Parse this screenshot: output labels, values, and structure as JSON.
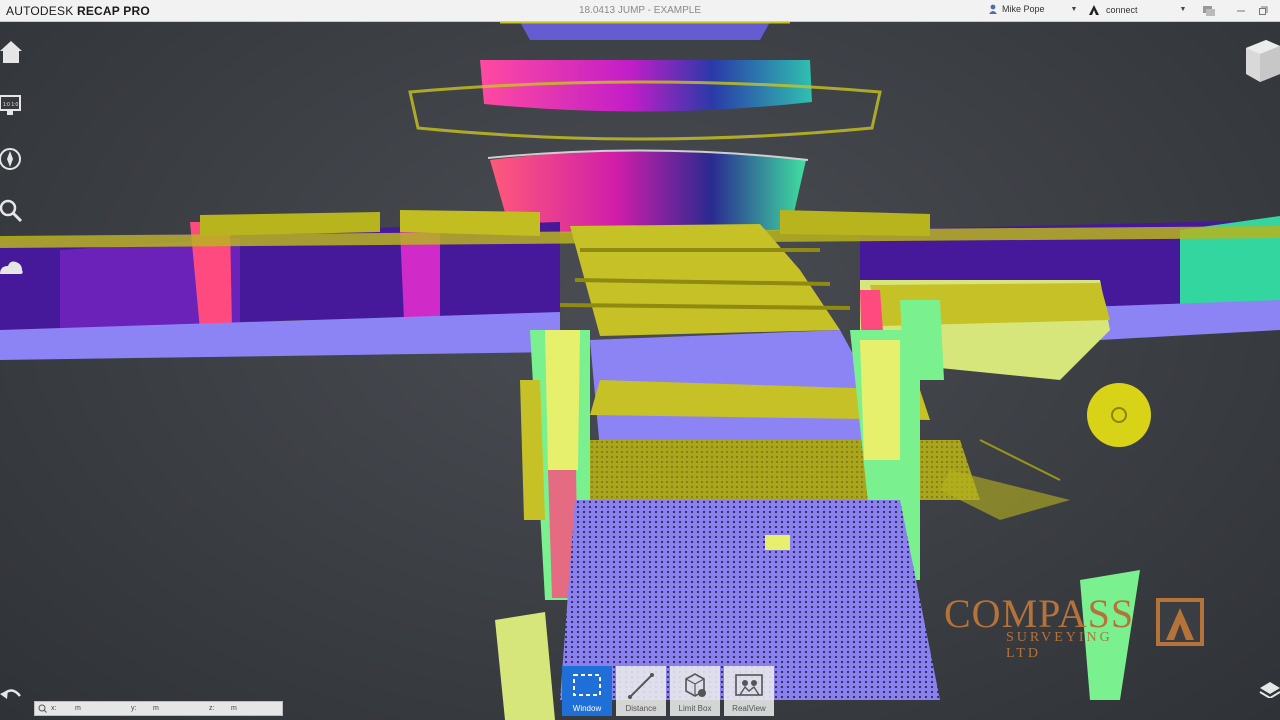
{
  "titlebar": {
    "brand_prefix": "AUTODESK",
    "brand_product": "RECAP PRO",
    "doc_title": "18.0413 JUMP - EXAMPLE",
    "user_name": "Mike Pope",
    "connect_label": "connect"
  },
  "left_nav": {
    "icons": [
      "home-icon",
      "screen-icon",
      "compass-icon",
      "search-icon",
      "cloud-icon"
    ],
    "screen_icon_text": "1:0 1:0"
  },
  "watermark": {
    "name": "COMPASS",
    "subtitle": "SURVEYING LTD"
  },
  "toolbar": {
    "tools": [
      {
        "label": "Window",
        "icon": "window-select-icon",
        "active": true
      },
      {
        "label": "Distance",
        "icon": "distance-icon",
        "active": false
      },
      {
        "label": "Limit Box",
        "icon": "limit-box-icon",
        "active": false
      },
      {
        "label": "RealView",
        "icon": "realview-icon",
        "active": false
      }
    ]
  },
  "coords": {
    "x_label": "x:",
    "x_unit": "m",
    "y_label": "y:",
    "y_unit": "m",
    "z_label": "z:",
    "z_unit": "m"
  },
  "colors": {
    "accent": "#1e6fd8",
    "viewport_bg": "#3a3d42",
    "pointcloud_yellow": "#b8b41e",
    "pointcloud_violet": "#8a7ef2",
    "pointcloud_purple": "#4a1e9c",
    "pointcloud_magenta": "#e02f8a",
    "pointcloud_green": "#7af08e",
    "watermark": "#b5733a"
  }
}
